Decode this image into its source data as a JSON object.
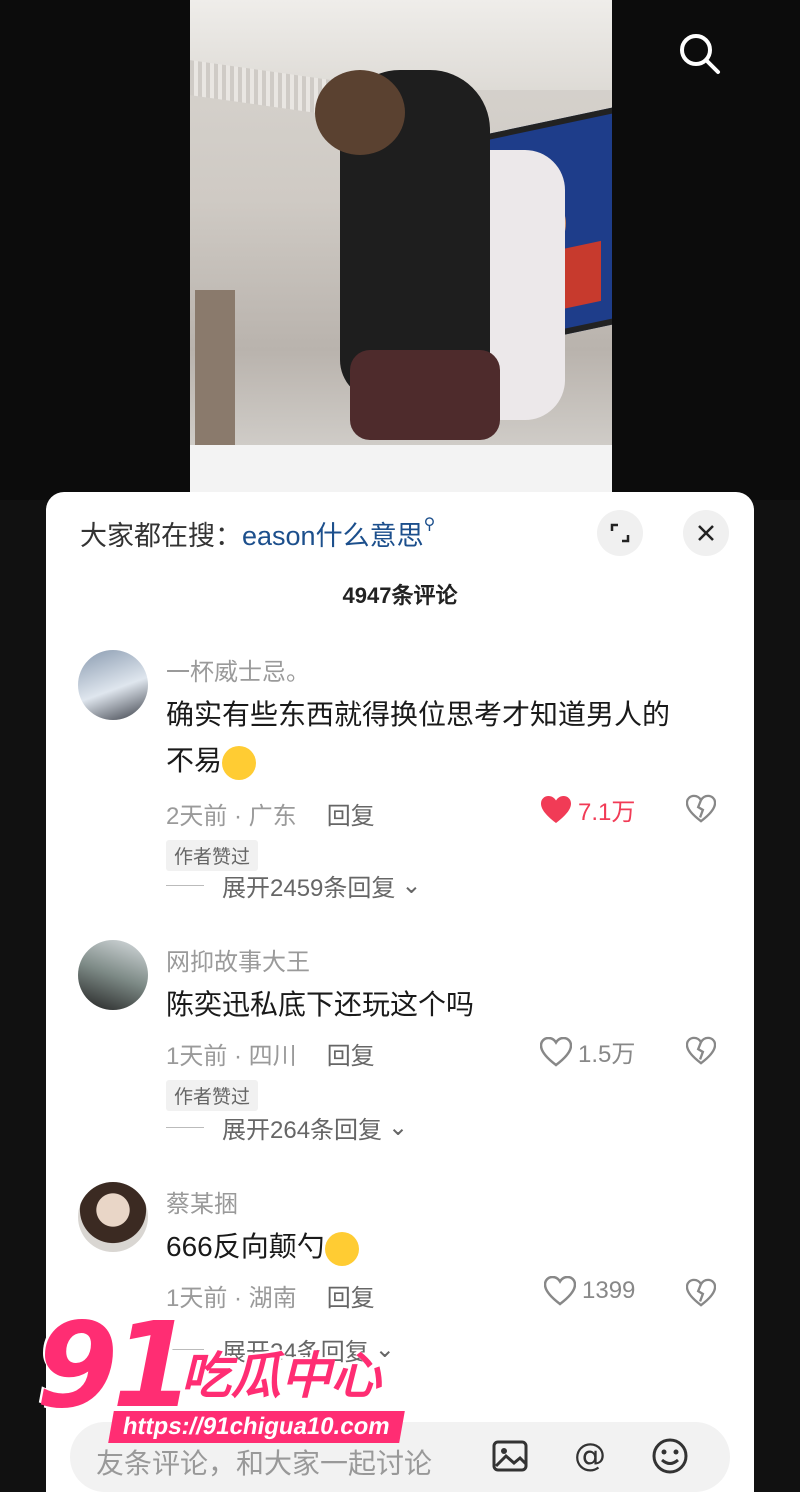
{
  "sheet": {
    "hot_search_label": "大家都在搜：",
    "hot_search_term": "eason什么意思",
    "comment_count": "4947条评论"
  },
  "comments": [
    {
      "user": "一杯威士忌。",
      "text_lines": [
        "确实有些东西就得换位思考才知道男人的",
        "不易"
      ],
      "time_location": "2天前 · 广东",
      "reply": "回复",
      "likes": "7.1万",
      "liked": true,
      "badge": "作者赞过",
      "expand": "展开2459条回复"
    },
    {
      "user": "网抑故事大王",
      "text_lines": [
        "陈奕迅私底下还玩这个吗"
      ],
      "time_location": "1天前 · 四川",
      "reply": "回复",
      "likes": "1.5万",
      "liked": false,
      "badge": "作者赞过",
      "expand": "展开264条回复"
    },
    {
      "user": "蔡某捆",
      "text_lines": [
        "666反向颠勺"
      ],
      "time_location": "1天前 · 湖南",
      "reply": "回复",
      "likes": "1399",
      "liked": false,
      "expand": "展开24条回复"
    }
  ],
  "input": {
    "placeholder": "友条评论，和大家一起讨论"
  },
  "watermark": {
    "number": "91",
    "title": "吃瓜中心",
    "url": "https://91chigua10.com"
  },
  "colors": {
    "accent": "#f13b56",
    "link": "#1c4f8c",
    "watermark": "#ff2d73"
  },
  "icons": [
    "search-icon",
    "expand-icon",
    "close-icon",
    "heart-icon",
    "dislike-heart-icon",
    "image-icon",
    "at-icon",
    "emoji-icon"
  ]
}
